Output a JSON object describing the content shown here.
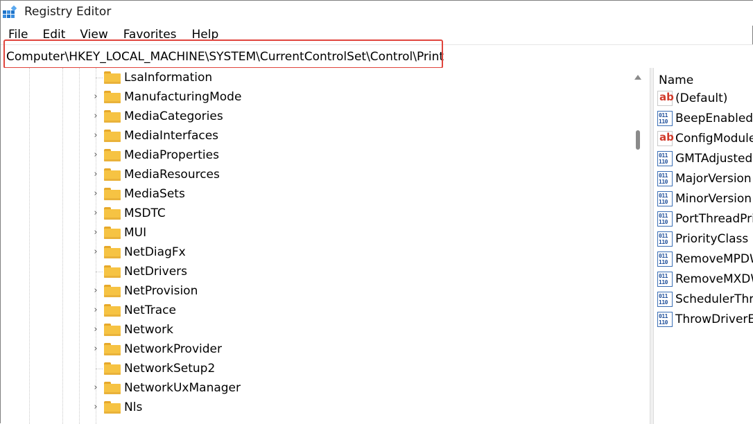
{
  "window": {
    "title": "Registry Editor"
  },
  "menu": [
    "File",
    "Edit",
    "View",
    "Favorites",
    "Help"
  ],
  "address": {
    "path": "Computer\\HKEY_LOCAL_MACHINE\\SYSTEM\\CurrentControlSet\\Control\\Print"
  },
  "tree": {
    "items": [
      {
        "label": "LsaInformation",
        "expandable": false
      },
      {
        "label": "ManufacturingMode",
        "expandable": true
      },
      {
        "label": "MediaCategories",
        "expandable": true
      },
      {
        "label": "MediaInterfaces",
        "expandable": true
      },
      {
        "label": "MediaProperties",
        "expandable": true
      },
      {
        "label": "MediaResources",
        "expandable": true
      },
      {
        "label": "MediaSets",
        "expandable": true
      },
      {
        "label": "MSDTC",
        "expandable": true
      },
      {
        "label": "MUI",
        "expandable": true
      },
      {
        "label": "NetDiagFx",
        "expandable": true
      },
      {
        "label": "NetDrivers",
        "expandable": false
      },
      {
        "label": "NetProvision",
        "expandable": true
      },
      {
        "label": "NetTrace",
        "expandable": true
      },
      {
        "label": "Network",
        "expandable": true
      },
      {
        "label": "NetworkProvider",
        "expandable": true
      },
      {
        "label": "NetworkSetup2",
        "expandable": false
      },
      {
        "label": "NetworkUxManager",
        "expandable": true
      },
      {
        "label": "Nls",
        "expandable": true
      }
    ]
  },
  "values": {
    "column_header": "Name",
    "items": [
      {
        "name": "(Default)",
        "type": "string"
      },
      {
        "name": "BeepEnabled",
        "type": "binary"
      },
      {
        "name": "ConfigModule",
        "type": "string"
      },
      {
        "name": "GMTAdjustedF",
        "type": "binary"
      },
      {
        "name": "MajorVersion",
        "type": "binary"
      },
      {
        "name": "MinorVersion",
        "type": "binary"
      },
      {
        "name": "PortThreadPrio",
        "type": "binary"
      },
      {
        "name": "PriorityClass",
        "type": "binary"
      },
      {
        "name": "RemoveMPDW",
        "type": "binary"
      },
      {
        "name": "RemoveMXDW",
        "type": "binary"
      },
      {
        "name": "SchedulerThre",
        "type": "binary"
      },
      {
        "name": "ThrowDriverEx",
        "type": "binary"
      }
    ]
  },
  "icons": {
    "string": "ab",
    "binary": "011\n110"
  },
  "colors": {
    "highlight_box": "#e0443c",
    "folder": "#f6c343"
  }
}
